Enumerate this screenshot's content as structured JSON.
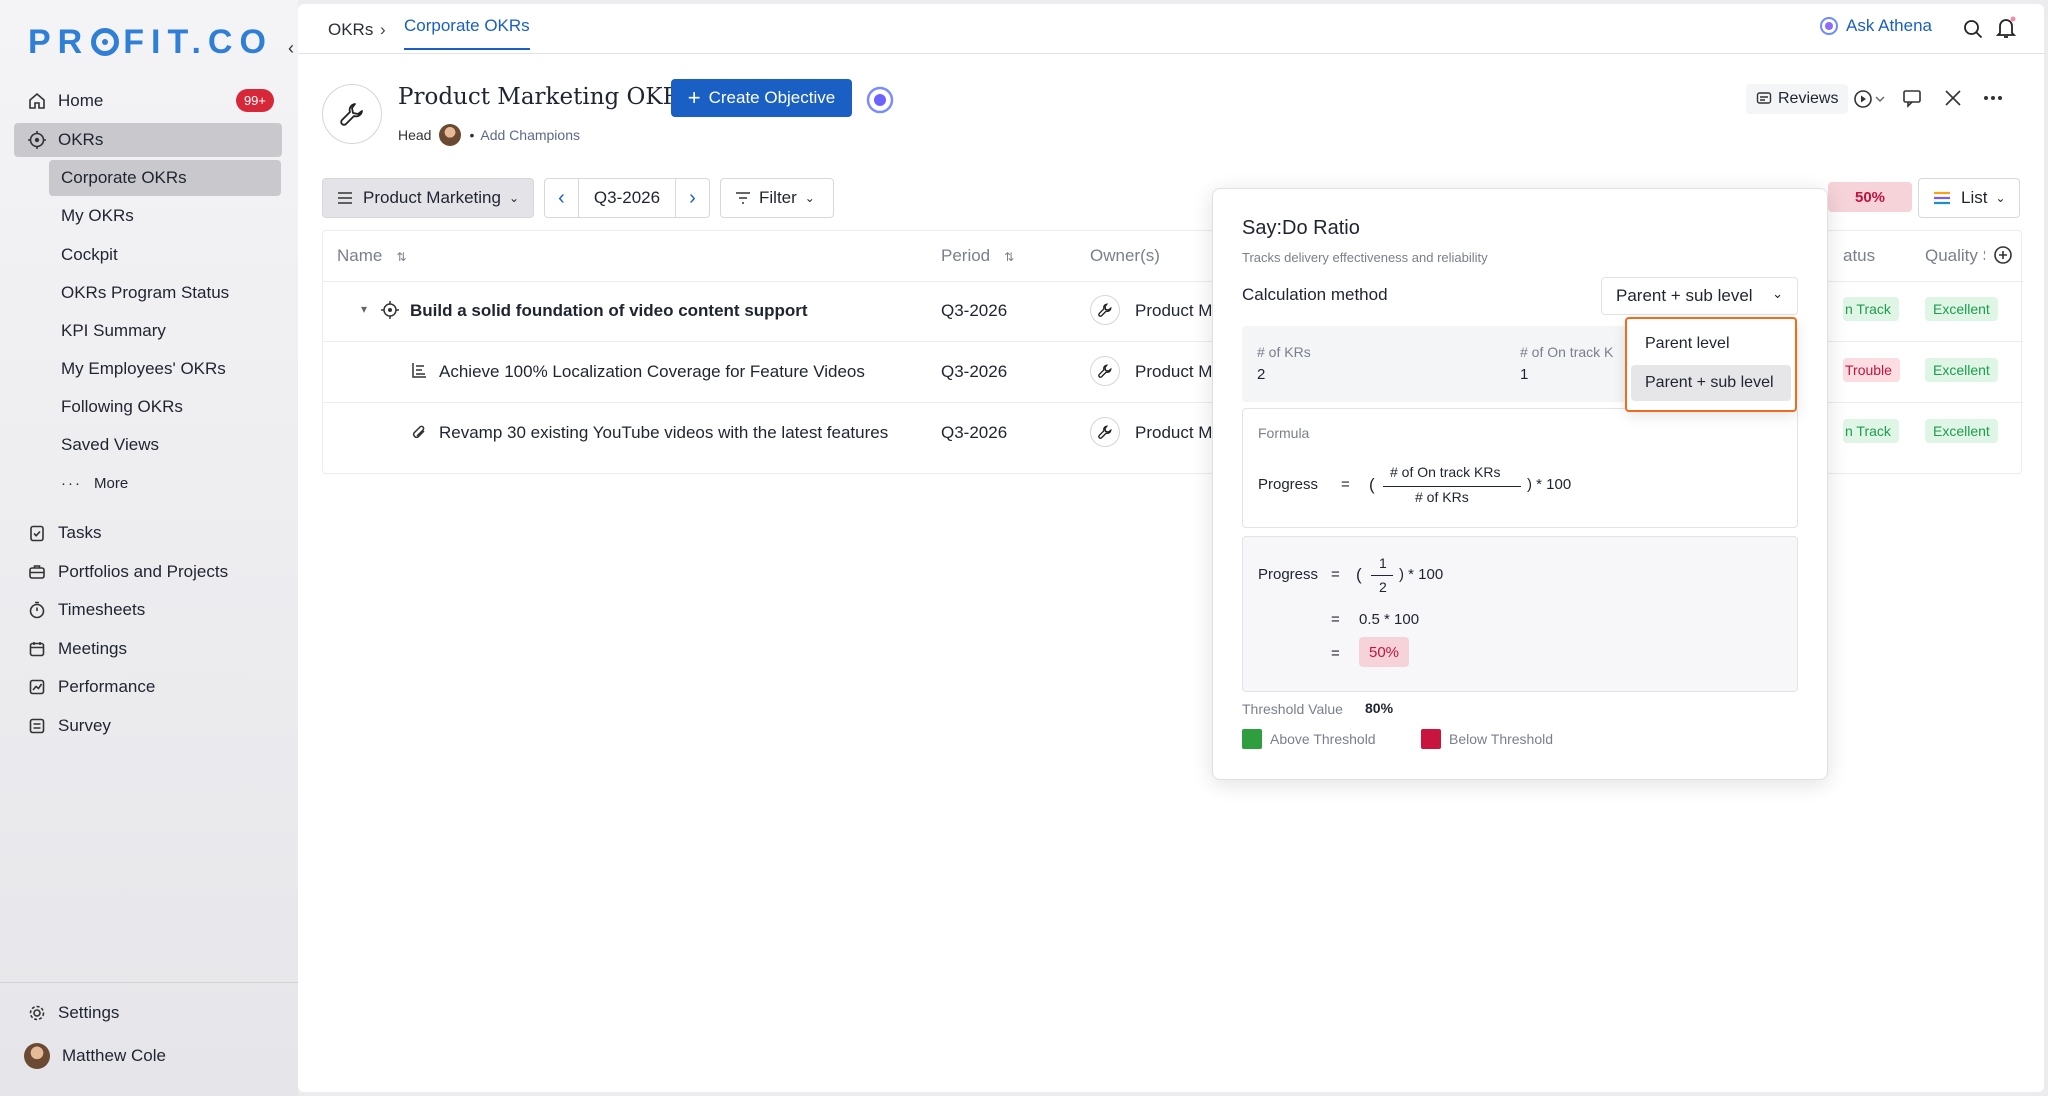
{
  "sidebar": {
    "logo": "PR",
    "logo_tail": "FIT.CO",
    "nav": [
      {
        "label": "Home",
        "badge": "99+"
      },
      {
        "label": "OKRs"
      }
    ],
    "okr_sub": [
      "Corporate OKRs",
      "My OKRs",
      "Cockpit",
      "OKRs Program Status",
      "KPI Summary",
      "My Employees' OKRs",
      "Following OKRs",
      "Saved Views"
    ],
    "more": "More",
    "nav2": [
      "Tasks",
      "Portfolios and Projects",
      "Timesheets",
      "Meetings",
      "Performance",
      "Survey"
    ],
    "settings": "Settings",
    "user": "Matthew Cole"
  },
  "topbar": {
    "crumb_root": "OKRs",
    "crumb_active": "Corporate OKRs",
    "ask": "Ask Athena"
  },
  "header": {
    "title": "Product Marketing OKRs",
    "create_label": "Create Objective",
    "head_label": "Head",
    "champions": "Add Champions",
    "reviews": "Reviews"
  },
  "toolbar": {
    "group": "Product Marketing",
    "period": "Q3-2026",
    "filter": "Filter",
    "ratio": "50%",
    "view": "List"
  },
  "table": {
    "columns": {
      "name": "Name",
      "period": "Period",
      "owner": "Owner(s)",
      "status": "atus",
      "quality": "Quality S"
    },
    "rows": [
      {
        "name": "Build a solid foundation of video content support",
        "period": "Q3-2026",
        "owner": "Product M",
        "status": "n Track",
        "quality": "Excellent"
      },
      {
        "name": "Achieve 100% Localization Coverage for Feature Videos",
        "period": "Q3-2026",
        "owner": "Product M",
        "status": "Trouble",
        "quality": "Excellent"
      },
      {
        "name": "Revamp 30 existing YouTube videos with the latest features",
        "period": "Q3-2026",
        "owner": "Product M",
        "status": "n Track",
        "quality": "Excellent"
      }
    ]
  },
  "popup": {
    "title": "Say:Do Ratio",
    "subtitle": "Tracks delivery effectiveness and reliability",
    "calc_label": "Calculation method",
    "calc_value": "Parent + sub level",
    "krs_label": "# of KRs",
    "krs_value": "2",
    "ontrack_label": "# of On track K",
    "ontrack_value": "1",
    "formula_label": "Formula",
    "progress": "Progress",
    "eq": "=",
    "paren_open": "(",
    "formula_num": "# of On track KRs",
    "formula_den": "# of KRs",
    "formula_tail": ") * 100",
    "num": "1",
    "den": "2",
    "step2": "0.5 * 100",
    "result": "50%",
    "threshold_label": "Threshold Value",
    "threshold_value": "80%",
    "above": "Above Threshold",
    "below": "Below Threshold",
    "above_color": "#2e9e3e",
    "below_color": "#c8143f"
  },
  "dropdown": {
    "options": [
      "Parent level",
      "Parent + sub level"
    ],
    "selected": "Parent + sub level"
  }
}
